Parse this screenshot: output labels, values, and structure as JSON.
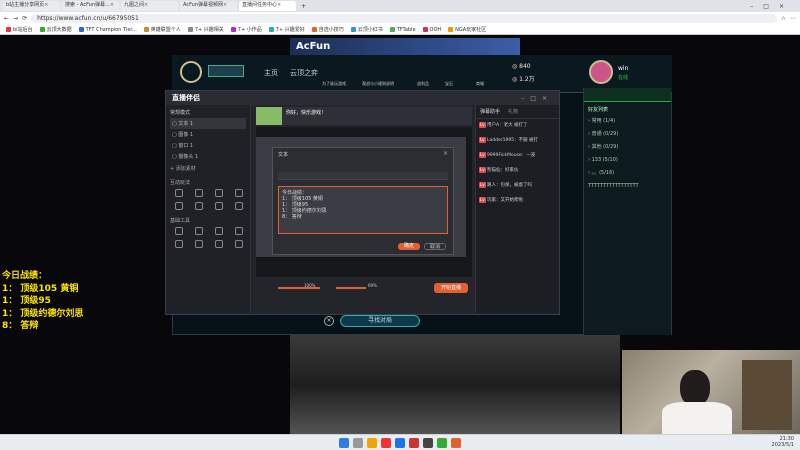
{
  "browser": {
    "tabs": [
      {
        "title": "b站主播分享网页"
      },
      {
        "title": "搜索 - AcFun弹幕..."
      },
      {
        "title": "九图之间"
      },
      {
        "title": "AcFun弹幕视频网"
      },
      {
        "title": "直播间任务中心"
      }
    ],
    "url": "https://www.acfun.cn/u/66795051",
    "bookmarks": [
      "bi站后台",
      "云顶大数据",
      "TFT Champion Tier...",
      "英雄联盟个人",
      "7+ 兴趣相关",
      "7+ 小作品",
      "7+ 兴趣爱好",
      "自选小技巧",
      "云顶小红书",
      "TFTable",
      "OOH",
      "NGA玩家社区"
    ]
  },
  "stream": {
    "acfun_banner": "AcFun",
    "lol": {
      "nav": [
        "主页",
        "云顶之弈"
      ],
      "sub_nav": [
        "为了谁玩游戏",
        "观战与小规则说明",
        "商城",
        "战利品",
        "宝石"
      ],
      "currency_be": "840",
      "currency_rp": "1.2万",
      "username": "win",
      "status": "在线",
      "find_match": "寻找对局",
      "friends_header": "好友列表",
      "friend_groups": [
        "常用 (1/4)",
        "普通 (0/29)",
        "其他 (0/29)",
        "133 (5/10)",
        "。。(5/16)"
      ],
      "friend_sample": "TTTTTTTTTTTTTTTTT"
    },
    "overlay": {
      "title": "今日战绩：",
      "lines": [
        "1：  顶级105 黄铜",
        "1：  顶级95",
        "1：  顶级约德尔刘思",
        "8：  答辩"
      ]
    }
  },
  "app": {
    "logo": "直播伴侣",
    "scene_label": "常规模式",
    "scenes": [
      "文本 1",
      "图像 1",
      "窗口 1",
      "摄像头 1"
    ],
    "add_source": "+ 添加素材",
    "interact_label": "互动玩法",
    "tools_label": "基础工具",
    "start_stream": "开始直播",
    "stream_title": "你好，快乐游戏！",
    "chat_tabs": [
      "弹幕助手",
      "礼物"
    ],
    "chat_messages": [
      {
        "user": "用户A",
        "text": "老大 被打了"
      },
      {
        "user": "Ladder1995",
        "text": "不服 被打"
      },
      {
        "user": "9999FickMouse",
        "text": "一波"
      },
      {
        "user": "熊猫仙",
        "text": "好家伙"
      },
      {
        "user": "路人",
        "text": "包保，被虐了吗"
      },
      {
        "user": "玩家",
        "text": "又开始爬啦"
      }
    ],
    "dialog": {
      "title": "文本",
      "text_lines": [
        "今日战绩：",
        "1：  顶级105 黄铜",
        "1：  顶级95",
        "1：  顶级约德尔刘思",
        "8：  答辩"
      ],
      "confirm": "确定",
      "cancel": "取消"
    },
    "volume_pct": "100%",
    "mic_pct": "69%"
  },
  "taskbar": {
    "time": "21:30",
    "date": "2023/5/1"
  }
}
